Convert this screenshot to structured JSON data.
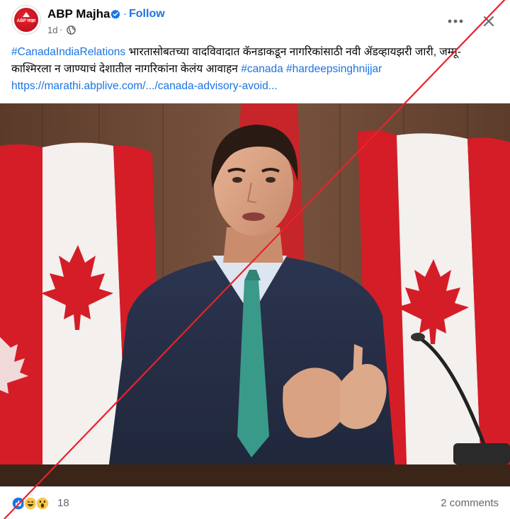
{
  "post": {
    "page_name": "ABP Majha",
    "avatar_text": "ABP माझा",
    "separator": "·",
    "follow_label": "Follow",
    "time": "1d",
    "meta_separator": "·",
    "visibility_icon": "globe-icon",
    "verified_icon": "verified-badge-icon",
    "caption": {
      "hashtag_1": "#CanadaIndiaRelations",
      "text": " भारतासोबतच्या वादविवादात कॅनडाकडून नागरिकांसाठी नवी ॲडव्हायझरी जारी, जम्मू-काश्मिरला न जाण्याचं देशातील नागरिकांना केलंय आवाहन ",
      "hashtag_2": "#canada",
      "space": " ",
      "hashtag_3": "#hardeepsinghnijjar"
    },
    "link": "https://marathi.abplive.com/.../canada-advisory-avoid...",
    "image_icon": "speaker-at-podium-photo"
  },
  "footer": {
    "reaction_icons": [
      "like-icon",
      "haha-icon",
      "wow-icon"
    ],
    "reaction_count": "18",
    "comments_label": "2 comments"
  },
  "colors": {
    "link_blue": "#1b74e4",
    "secondary_text": "#65676b",
    "strike_red": "#e8232a",
    "flag_red": "#d51d27"
  }
}
